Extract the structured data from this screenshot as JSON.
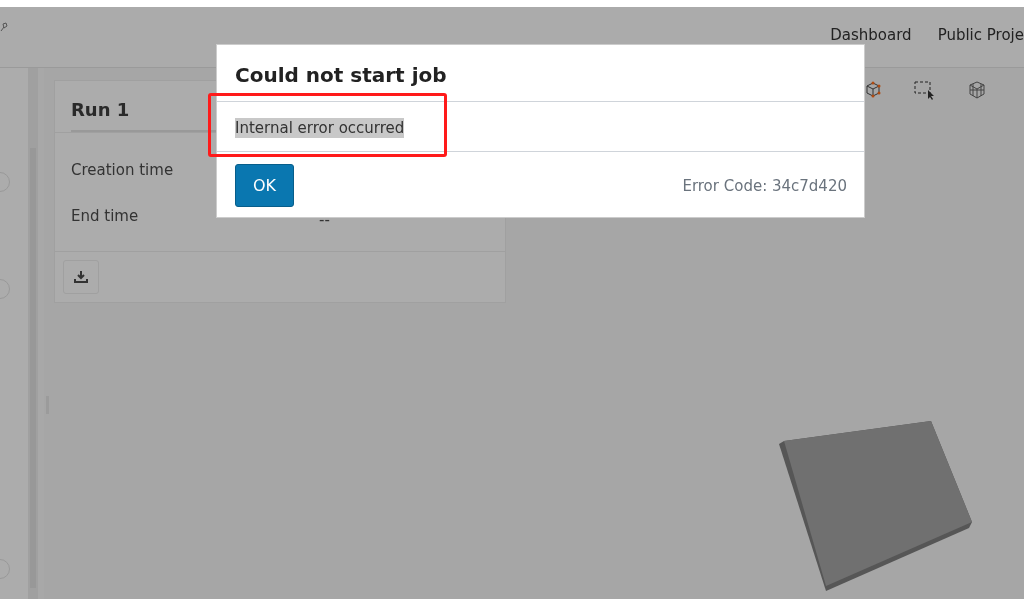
{
  "nav": {
    "links": [
      "Dashboard",
      "Public Proje"
    ]
  },
  "run_panel": {
    "title": "Run 1",
    "fields": [
      {
        "label": "Creation time"
      },
      {
        "label": "End time",
        "value": "--"
      }
    ]
  },
  "dialog": {
    "title": "Could not start job",
    "message": "Internal error occurred",
    "ok_button": "OK",
    "error_code": "Error Code: 34c7d420"
  }
}
